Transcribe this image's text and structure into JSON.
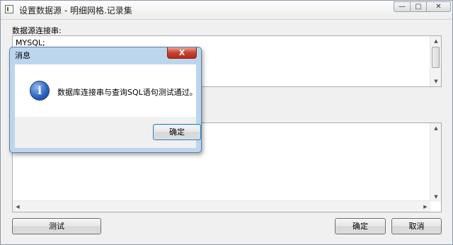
{
  "window": {
    "title": "设置数据源 - 明细网格.记录集",
    "controls": {
      "minimize": "—",
      "maximize": "▢",
      "close": "✕"
    }
  },
  "connection": {
    "label": "数据源连接串:",
    "value": "MYSQL;"
  },
  "buttons": {
    "test": "测试",
    "ok": "确定",
    "cancel": "取消"
  },
  "dialog": {
    "title": "消息",
    "close": "X",
    "icon": "info-icon",
    "message": "数据库连接串与查询SQL语句测试通过。",
    "ok": "确定"
  },
  "icons": {
    "app": "window-app-icon",
    "info": "info-icon",
    "scroll_up": "▲",
    "scroll_down": "▼",
    "scroll_left": "◀",
    "scroll_right": "▶"
  },
  "colors": {
    "dialog_frame": "#bcd6ee",
    "close_button": "#c7432e",
    "info_icon": "#2a5fbf"
  }
}
